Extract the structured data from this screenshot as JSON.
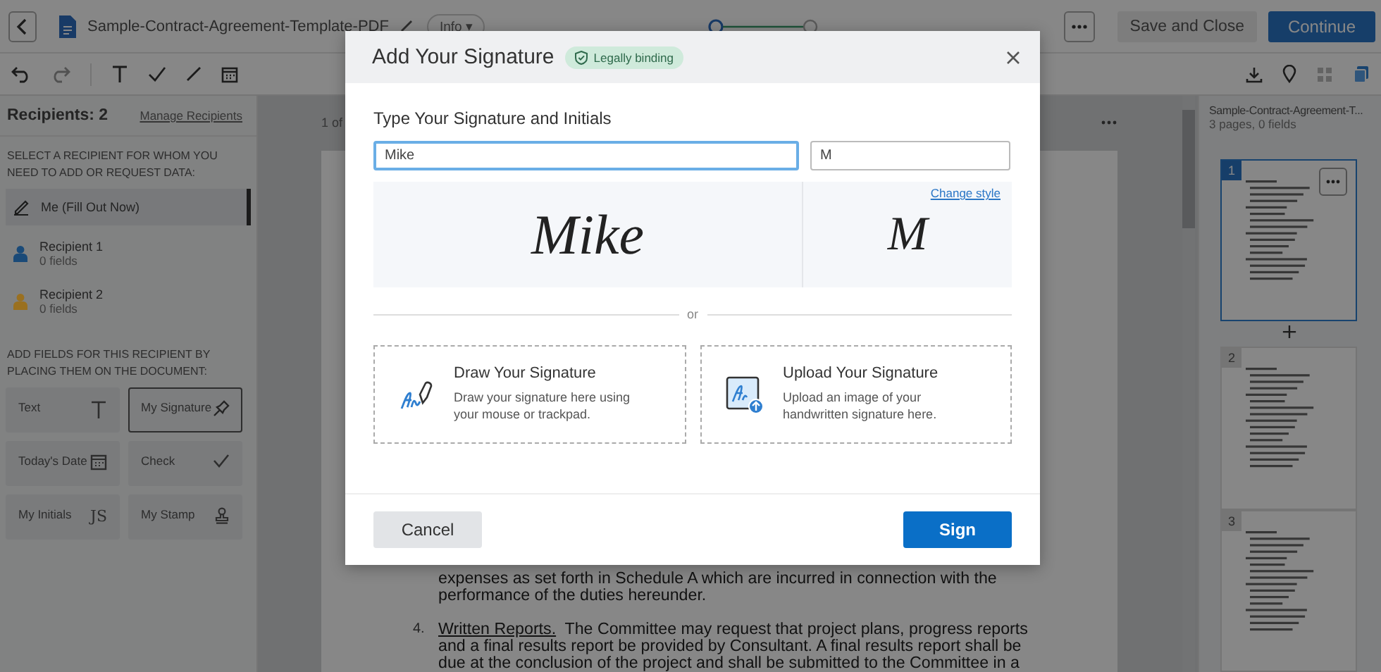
{
  "topbar": {
    "document_title": "Sample-Contract-Agreement-Template-PDF",
    "info_label": "Info",
    "info_caret": "▾",
    "save_button": "Save and Close",
    "continue_button": "Continue"
  },
  "sidebar": {
    "recipients_heading": "Recipients: 2",
    "manage_link": "Manage Recipients",
    "select_prompt": "SELECT A RECIPIENT FOR WHOM YOU NEED TO ADD OR REQUEST DATA:",
    "recipients": [
      {
        "kind": "self",
        "name": "Me (Fill Out Now)",
        "selected": true
      },
      {
        "kind": "recipient",
        "name": "Recipient 1",
        "fields": "0 fields",
        "color": "#1a4a78",
        "selected": false
      },
      {
        "kind": "recipient",
        "name": "Recipient 2",
        "fields": "0 fields",
        "color": "#9a7020",
        "selected": false
      }
    ],
    "fields_prompt": "ADD FIELDS FOR THIS RECIPIENT BY PLACING THEM ON THE DOCUMENT:",
    "field_tools": [
      {
        "kind": "text",
        "label": "Text",
        "selected": false
      },
      {
        "kind": "signature",
        "label": "My Signature",
        "selected": true
      },
      {
        "kind": "date",
        "label": "Today's Date",
        "selected": false
      },
      {
        "kind": "check",
        "label": "Check",
        "selected": false
      },
      {
        "kind": "initials",
        "label": "My Initials",
        "icon_text": "JS",
        "selected": false
      },
      {
        "kind": "stamp",
        "label": "My Stamp",
        "selected": false
      }
    ]
  },
  "document": {
    "page_counter": "1 of",
    "lines": [
      "expenses as set forth in Schedule A which are incurred in connection with the",
      "performance of the duties hereunder."
    ],
    "item": {
      "number": "4.",
      "heading": "Written Reports.",
      "lines": [
        "The Committee may request that project plans, progress reports",
        "and a final results report be provided by Consultant.   A final results report shall be",
        "due at the conclusion of the project and shall be submitted to the Committee in a"
      ]
    }
  },
  "thumbnails_panel": {
    "title": "Sample-Contract-Agreement-T...",
    "subtitle": "3 pages, 0 fields",
    "pages": [
      {
        "number": "1",
        "selected": true
      },
      {
        "number": "2",
        "selected": false
      },
      {
        "number": "3",
        "selected": false
      }
    ]
  },
  "dialog": {
    "title": "Add Your Signature",
    "badge": "Legally binding",
    "section_label": "Type Your Signature and Initials",
    "signature_input": {
      "value": "Mike",
      "focused": true
    },
    "initials_input": {
      "value": "M",
      "focused": false
    },
    "signature_preview": "Mike",
    "initials_preview": "M",
    "change_style_link": "Change style",
    "divider_label": "or",
    "options": [
      {
        "kind": "draw",
        "title": "Draw Your Signature",
        "description": "Draw your signature here using your mouse or trackpad."
      },
      {
        "kind": "upload",
        "title": "Upload Your Signature",
        "description": "Upload an image of your handwritten signature here."
      }
    ],
    "cancel_button": "Cancel",
    "sign_button": "Sign"
  }
}
